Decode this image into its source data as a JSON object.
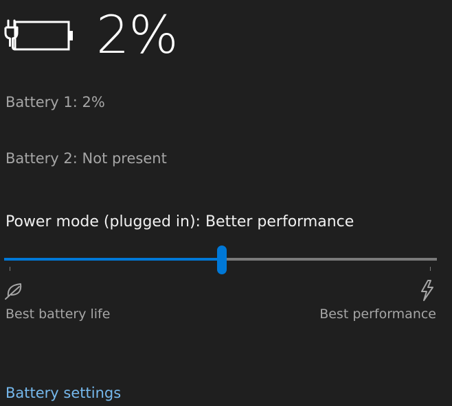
{
  "battery": {
    "percent_label": "2%",
    "icon": "battery-charging-icon",
    "battery1": "Battery 1: 2%",
    "battery2": "Battery 2: Not present"
  },
  "power_mode": {
    "label": "Power mode (plugged in): Better performance",
    "slider_value_fraction": 0.5,
    "left_icon": "leaf-icon",
    "right_icon": "lightning-bolt-icon",
    "left_label": "Best battery life",
    "right_label": "Best performance"
  },
  "links": {
    "battery_settings": "Battery settings"
  },
  "colors": {
    "background": "#1f1f1f",
    "accent": "#0078d7",
    "link": "#76b9ed",
    "secondary_text": "#a6a6a6",
    "track": "#7a7a7a"
  }
}
